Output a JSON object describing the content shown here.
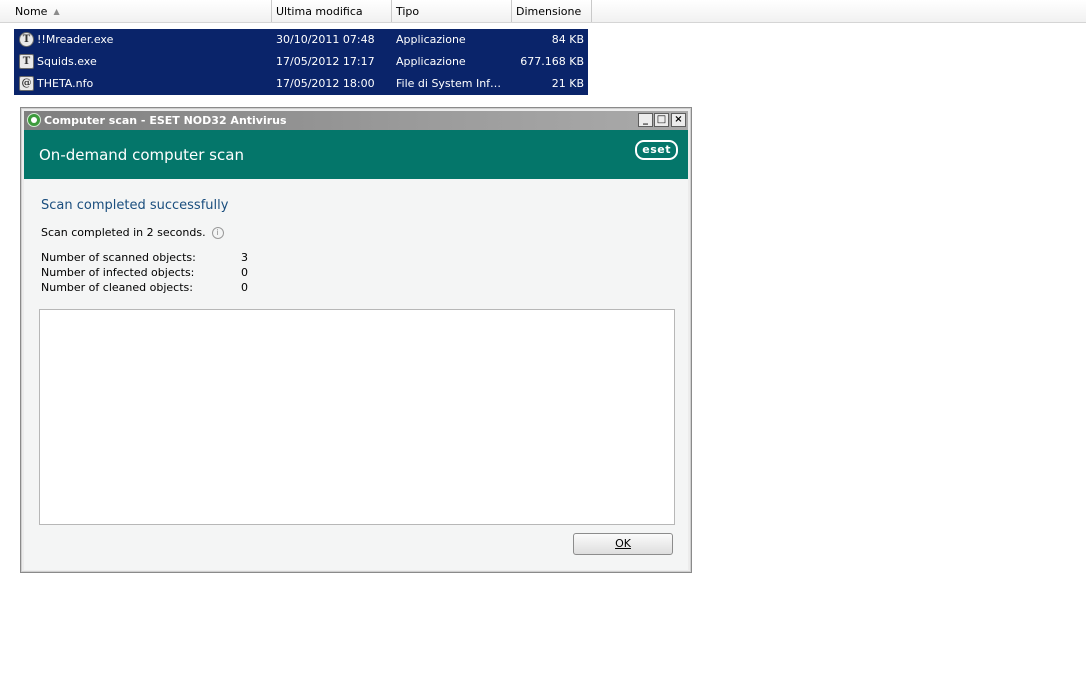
{
  "explorer": {
    "columns": [
      {
        "label": "Nome"
      },
      {
        "label": "Ultima modifica"
      },
      {
        "label": "Tipo"
      },
      {
        "label": "Dimensione"
      }
    ],
    "sort_icon": "sort-ascending-icon",
    "files": [
      {
        "name": "!!Mreader.exe",
        "date": "30/10/2011 07:48",
        "type": "Applicazione",
        "size": "84 KB",
        "icon": "app-t-icon",
        "icon_glyph": "T"
      },
      {
        "name": "Squids.exe",
        "date": "17/05/2012 17:17",
        "type": "Applicazione",
        "size": "677.168 KB",
        "icon": "app-ts-icon",
        "icon_glyph": "T"
      },
      {
        "name": "THETA.nfo",
        "date": "17/05/2012 18:00",
        "type": "File di System Infor…",
        "size": "21 KB",
        "icon": "system-info-icon",
        "icon_glyph": "@"
      }
    ],
    "selection_color": "#0a246a"
  },
  "dialog": {
    "window_title": "Computer scan - ESET NOD32 Antivirus",
    "header_title": "On-demand computer scan",
    "logo_text": "eset",
    "header_color": "#04766a",
    "status_heading": "Scan completed successfully",
    "completed_text": "Scan completed in 2 seconds.",
    "stats": [
      {
        "label": "Number of scanned objects:",
        "value": "3"
      },
      {
        "label": "Number of infected objects:",
        "value": "0"
      },
      {
        "label": "Number of cleaned objects:",
        "value": "0"
      }
    ],
    "ok_label": "OK",
    "window_buttons": {
      "minimize": "_",
      "maximize": "□",
      "close": "×"
    }
  }
}
